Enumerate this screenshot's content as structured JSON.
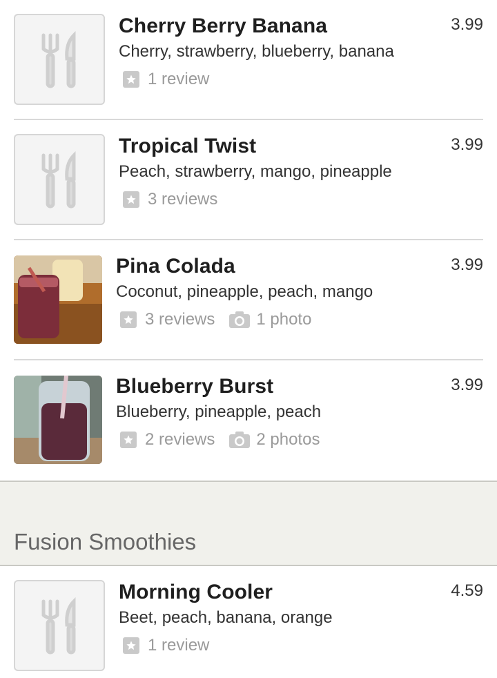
{
  "items": [
    {
      "name": "Cherry Berry Banana",
      "description": "Cherry, strawberry, blueberry, banana",
      "price": "3.99",
      "reviews": "1 review",
      "photos": null,
      "image": "placeholder"
    },
    {
      "name": "Tropical Twist",
      "description": "Peach, strawberry, mango, pineapple",
      "price": "3.99",
      "reviews": "3 reviews",
      "photos": null,
      "image": "placeholder"
    },
    {
      "name": "Pina Colada",
      "description": "Coconut, pineapple, peach, mango",
      "price": "3.99",
      "reviews": "3 reviews",
      "photos": "1 photo",
      "image": "photo"
    },
    {
      "name": "Blueberry Burst",
      "description": "Blueberry, pineapple, peach",
      "price": "3.99",
      "reviews": "2 reviews",
      "photos": "2 photos",
      "image": "photo"
    }
  ],
  "section": {
    "title": "Fusion Smoothies",
    "items": [
      {
        "name": "Morning Cooler",
        "description": "Beet, peach, banana, orange",
        "price": "4.59",
        "reviews": "1 review",
        "photos": null,
        "image": "placeholder"
      }
    ]
  },
  "icons": {
    "placeholder": "fork-knife-icon",
    "review": "star-icon",
    "photo": "camera-icon"
  },
  "colors": {
    "section_bg": "#f1f1ec",
    "meta_text": "#9a9a9a",
    "divider": "#d9d9d9"
  }
}
